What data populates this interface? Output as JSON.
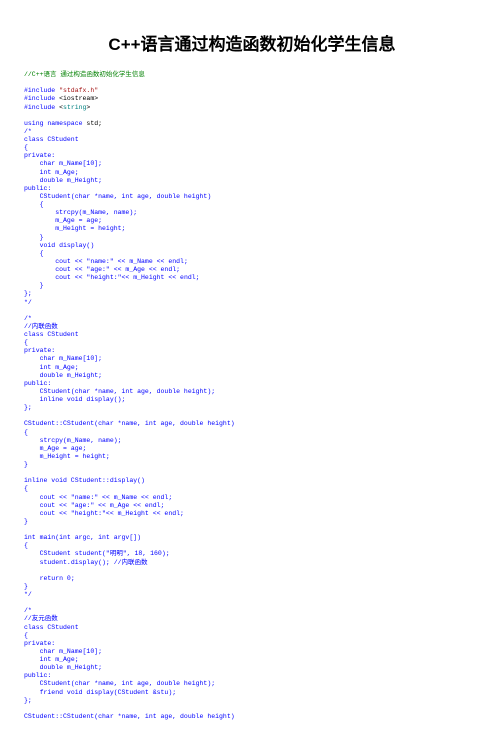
{
  "title": "C++语言通过构造函数初始化学生信息",
  "code_lines": [
    {
      "indent": 0,
      "spans": [
        {
          "t": "//C++语言 通过构造函数初始化学生信息",
          "c": "c-green"
        }
      ]
    },
    {
      "indent": 0,
      "spans": []
    },
    {
      "indent": 0,
      "spans": [
        {
          "t": "#include ",
          "c": "c-blue"
        },
        {
          "t": "\"stdafx.h\"",
          "c": "c-red"
        }
      ]
    },
    {
      "indent": 0,
      "spans": [
        {
          "t": "#include ",
          "c": "c-blue"
        },
        {
          "t": "<iostream>",
          "c": "c-black"
        }
      ]
    },
    {
      "indent": 0,
      "spans": [
        {
          "t": "#include ",
          "c": "c-blue"
        },
        {
          "t": "<",
          "c": "c-black"
        },
        {
          "t": "string",
          "c": "c-teal"
        },
        {
          "t": ">",
          "c": "c-black"
        }
      ]
    },
    {
      "indent": 0,
      "spans": []
    },
    {
      "indent": 0,
      "spans": [
        {
          "t": "using namespace ",
          "c": "c-blue"
        },
        {
          "t": "std;",
          "c": "c-black"
        }
      ]
    },
    {
      "indent": 0,
      "spans": [
        {
          "t": "/*",
          "c": "c-blue"
        }
      ]
    },
    {
      "indent": 0,
      "spans": [
        {
          "t": "class CStudent",
          "c": "c-blue"
        }
      ]
    },
    {
      "indent": 0,
      "spans": [
        {
          "t": "{",
          "c": "c-blue"
        }
      ]
    },
    {
      "indent": 0,
      "spans": [
        {
          "t": "private:",
          "c": "c-blue"
        }
      ]
    },
    {
      "indent": 1,
      "spans": [
        {
          "t": "char m_Name[10];",
          "c": "c-blue"
        }
      ]
    },
    {
      "indent": 1,
      "spans": [
        {
          "t": "int m_Age;",
          "c": "c-blue"
        }
      ]
    },
    {
      "indent": 1,
      "spans": [
        {
          "t": "double m_Height;",
          "c": "c-blue"
        }
      ]
    },
    {
      "indent": 0,
      "spans": [
        {
          "t": "public:",
          "c": "c-blue"
        }
      ]
    },
    {
      "indent": 1,
      "spans": [
        {
          "t": "CStudent(char *name, int age, double height)",
          "c": "c-blue"
        }
      ]
    },
    {
      "indent": 1,
      "spans": [
        {
          "t": "{",
          "c": "c-blue"
        }
      ]
    },
    {
      "indent": 2,
      "spans": [
        {
          "t": "strcpy(m_Name, name);",
          "c": "c-blue"
        }
      ]
    },
    {
      "indent": 2,
      "spans": [
        {
          "t": "m_Age = age;",
          "c": "c-blue"
        }
      ]
    },
    {
      "indent": 2,
      "spans": [
        {
          "t": "m_Height = height;",
          "c": "c-blue"
        }
      ]
    },
    {
      "indent": 1,
      "spans": [
        {
          "t": "}",
          "c": "c-blue"
        }
      ]
    },
    {
      "indent": 1,
      "spans": [
        {
          "t": "void display()",
          "c": "c-blue"
        }
      ]
    },
    {
      "indent": 1,
      "spans": [
        {
          "t": "{",
          "c": "c-blue"
        }
      ]
    },
    {
      "indent": 2,
      "spans": [
        {
          "t": "cout << \"name:\" << m_Name << endl;",
          "c": "c-blue"
        }
      ]
    },
    {
      "indent": 2,
      "spans": [
        {
          "t": "cout << \"age:\" << m_Age << endl;",
          "c": "c-blue"
        }
      ]
    },
    {
      "indent": 2,
      "spans": [
        {
          "t": "cout << \"height:\"<< m_Height << endl;",
          "c": "c-blue"
        }
      ]
    },
    {
      "indent": 1,
      "spans": [
        {
          "t": "}",
          "c": "c-blue"
        }
      ]
    },
    {
      "indent": 0,
      "spans": [
        {
          "t": "};",
          "c": "c-blue"
        }
      ]
    },
    {
      "indent": 0,
      "spans": [
        {
          "t": "*/",
          "c": "c-blue"
        }
      ]
    },
    {
      "indent": 0,
      "spans": []
    },
    {
      "indent": 0,
      "spans": [
        {
          "t": "/*",
          "c": "c-blue"
        }
      ]
    },
    {
      "indent": 0,
      "spans": [
        {
          "t": "//内联函数",
          "c": "c-blue"
        }
      ]
    },
    {
      "indent": 0,
      "spans": [
        {
          "t": "class CStudent",
          "c": "c-blue"
        }
      ]
    },
    {
      "indent": 0,
      "spans": [
        {
          "t": "{",
          "c": "c-blue"
        }
      ]
    },
    {
      "indent": 0,
      "spans": [
        {
          "t": "private:",
          "c": "c-blue"
        }
      ]
    },
    {
      "indent": 1,
      "spans": [
        {
          "t": "char m_Name[10];",
          "c": "c-blue"
        }
      ]
    },
    {
      "indent": 1,
      "spans": [
        {
          "t": "int m_Age;",
          "c": "c-blue"
        }
      ]
    },
    {
      "indent": 1,
      "spans": [
        {
          "t": "double m_Height;",
          "c": "c-blue"
        }
      ]
    },
    {
      "indent": 0,
      "spans": [
        {
          "t": "public:",
          "c": "c-blue"
        }
      ]
    },
    {
      "indent": 1,
      "spans": [
        {
          "t": "CStudent(char *name, int age, double height);",
          "c": "c-blue"
        }
      ]
    },
    {
      "indent": 1,
      "spans": [
        {
          "t": "inline void display();",
          "c": "c-blue"
        }
      ]
    },
    {
      "indent": 0,
      "spans": [
        {
          "t": "};",
          "c": "c-blue"
        }
      ]
    },
    {
      "indent": 0,
      "spans": []
    },
    {
      "indent": 0,
      "spans": [
        {
          "t": "CStudent::CStudent(char *name, int age, double height)",
          "c": "c-blue"
        }
      ]
    },
    {
      "indent": 0,
      "spans": [
        {
          "t": "{",
          "c": "c-blue"
        }
      ]
    },
    {
      "indent": 1,
      "spans": [
        {
          "t": "strcpy(m_Name, name);",
          "c": "c-blue"
        }
      ]
    },
    {
      "indent": 1,
      "spans": [
        {
          "t": "m_Age = age;",
          "c": "c-blue"
        }
      ]
    },
    {
      "indent": 1,
      "spans": [
        {
          "t": "m_Height = height;",
          "c": "c-blue"
        }
      ]
    },
    {
      "indent": 0,
      "spans": [
        {
          "t": "}",
          "c": "c-blue"
        }
      ]
    },
    {
      "indent": 0,
      "spans": []
    },
    {
      "indent": 0,
      "spans": [
        {
          "t": "inline void CStudent::display()",
          "c": "c-blue"
        }
      ]
    },
    {
      "indent": 0,
      "spans": [
        {
          "t": "{",
          "c": "c-blue"
        }
      ]
    },
    {
      "indent": 1,
      "spans": [
        {
          "t": "cout << \"name:\" << m_Name << endl;",
          "c": "c-blue"
        }
      ]
    },
    {
      "indent": 1,
      "spans": [
        {
          "t": "cout << \"age:\" << m_Age << endl;",
          "c": "c-blue"
        }
      ]
    },
    {
      "indent": 1,
      "spans": [
        {
          "t": "cout << \"height:\"<< m_Height << endl;",
          "c": "c-blue"
        }
      ]
    },
    {
      "indent": 0,
      "spans": [
        {
          "t": "}",
          "c": "c-blue"
        }
      ]
    },
    {
      "indent": 0,
      "spans": []
    },
    {
      "indent": 0,
      "spans": [
        {
          "t": "int main(int argc, int argv[])",
          "c": "c-blue"
        }
      ]
    },
    {
      "indent": 0,
      "spans": [
        {
          "t": "{",
          "c": "c-blue"
        }
      ]
    },
    {
      "indent": 1,
      "spans": [
        {
          "t": "CStudent student(\"明明\", 18, 160);",
          "c": "c-blue"
        }
      ]
    },
    {
      "indent": 1,
      "spans": [
        {
          "t": "student.display(); //内联函数",
          "c": "c-blue"
        }
      ]
    },
    {
      "indent": 0,
      "spans": []
    },
    {
      "indent": 1,
      "spans": [
        {
          "t": "return 0;",
          "c": "c-blue"
        }
      ]
    },
    {
      "indent": 0,
      "spans": [
        {
          "t": "}",
          "c": "c-blue"
        }
      ]
    },
    {
      "indent": 0,
      "spans": [
        {
          "t": "*/",
          "c": "c-blue"
        }
      ]
    },
    {
      "indent": 0,
      "spans": []
    },
    {
      "indent": 0,
      "spans": [
        {
          "t": "/*",
          "c": "c-blue"
        }
      ]
    },
    {
      "indent": 0,
      "spans": [
        {
          "t": "//友元函数",
          "c": "c-blue"
        }
      ]
    },
    {
      "indent": 0,
      "spans": [
        {
          "t": "class CStudent",
          "c": "c-blue"
        }
      ]
    },
    {
      "indent": 0,
      "spans": [
        {
          "t": "{",
          "c": "c-blue"
        }
      ]
    },
    {
      "indent": 0,
      "spans": [
        {
          "t": "private:",
          "c": "c-blue"
        }
      ]
    },
    {
      "indent": 1,
      "spans": [
        {
          "t": "char m_Name[10];",
          "c": "c-blue"
        }
      ]
    },
    {
      "indent": 1,
      "spans": [
        {
          "t": "int m_Age;",
          "c": "c-blue"
        }
      ]
    },
    {
      "indent": 1,
      "spans": [
        {
          "t": "double m_Height;",
          "c": "c-blue"
        }
      ]
    },
    {
      "indent": 0,
      "spans": [
        {
          "t": "public:",
          "c": "c-blue"
        }
      ]
    },
    {
      "indent": 1,
      "spans": [
        {
          "t": "CStudent(char *name, int age, double height);",
          "c": "c-blue"
        }
      ]
    },
    {
      "indent": 1,
      "spans": [
        {
          "t": "friend void display(CStudent &stu);",
          "c": "c-blue"
        }
      ]
    },
    {
      "indent": 0,
      "spans": [
        {
          "t": "};",
          "c": "c-blue"
        }
      ]
    },
    {
      "indent": 0,
      "spans": []
    },
    {
      "indent": 0,
      "spans": [
        {
          "t": "CStudent::CStudent(char *name, int age, double height)",
          "c": "c-blue"
        }
      ]
    }
  ]
}
